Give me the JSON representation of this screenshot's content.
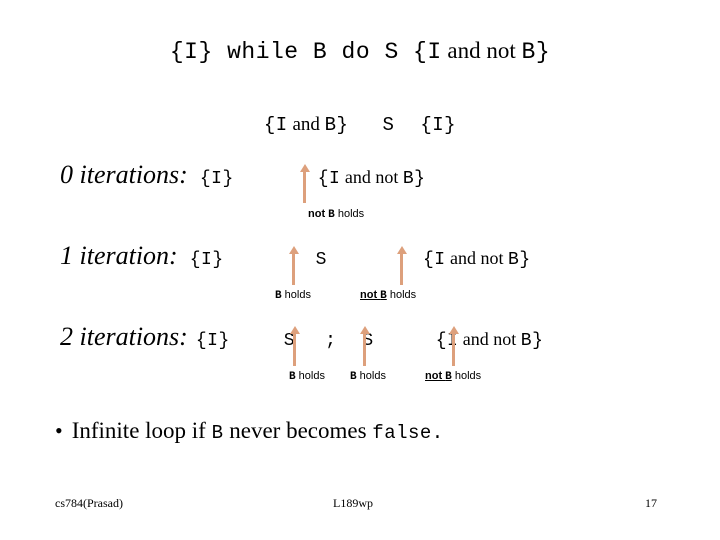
{
  "slide": {
    "background_color": "#ffffff",
    "text_color": "#000000",
    "arrow_color": "#dda07c"
  },
  "spec_top": {
    "pre": "{I}",
    "keyword_while": " while ",
    "cond": "B",
    "keyword_do": " do ",
    "stmt": "S",
    "post_open": " {I",
    "post_conn": " and not ",
    "post_close": "B}"
  },
  "spec_second": {
    "pre_open": "{I",
    "pre_conn": " and ",
    "pre_close": "B}",
    "stmt": "S",
    "post": "{I}"
  },
  "rows": [
    {
      "label": "0 iterations:",
      "pre": "{I}",
      "post_open": "{I",
      "post_conn": " and not ",
      "post_close": "B}"
    },
    {
      "label": "1 iteration:",
      "pre": "{I}",
      "stmt1": "S",
      "post_open": "{I",
      "post_conn": " and not ",
      "post_close": "B}"
    },
    {
      "label": "2 iterations:",
      "pre": "{I}",
      "stmt1": "S",
      "separator": ";",
      "stmt2": "S",
      "post_open": "{I",
      "post_conn": " and not ",
      "post_close": "B}"
    }
  ],
  "annotations": [
    {
      "negation": "not ",
      "variable": "B",
      "word": " holds",
      "underlined": false
    },
    {
      "negation": "",
      "variable": "B",
      "word": " holds",
      "underlined": false
    },
    {
      "negation": "not ",
      "variable": "B",
      "word": " holds",
      "underlined": true
    },
    {
      "negation": "",
      "variable": "B",
      "word": " holds",
      "underlined": false
    },
    {
      "negation": "",
      "variable": "B",
      "word": " holds",
      "underlined": false
    },
    {
      "negation": "not ",
      "variable": "B",
      "word": " holds",
      "underlined": true
    }
  ],
  "bullet": {
    "marker": "•",
    "text_before": "Infinite loop if ",
    "code_var": "B",
    "text_middle": " never becomes ",
    "code_value": "false."
  },
  "footer": {
    "course": "cs784(Prasad)",
    "lecture": "L189wp",
    "page": "17"
  }
}
